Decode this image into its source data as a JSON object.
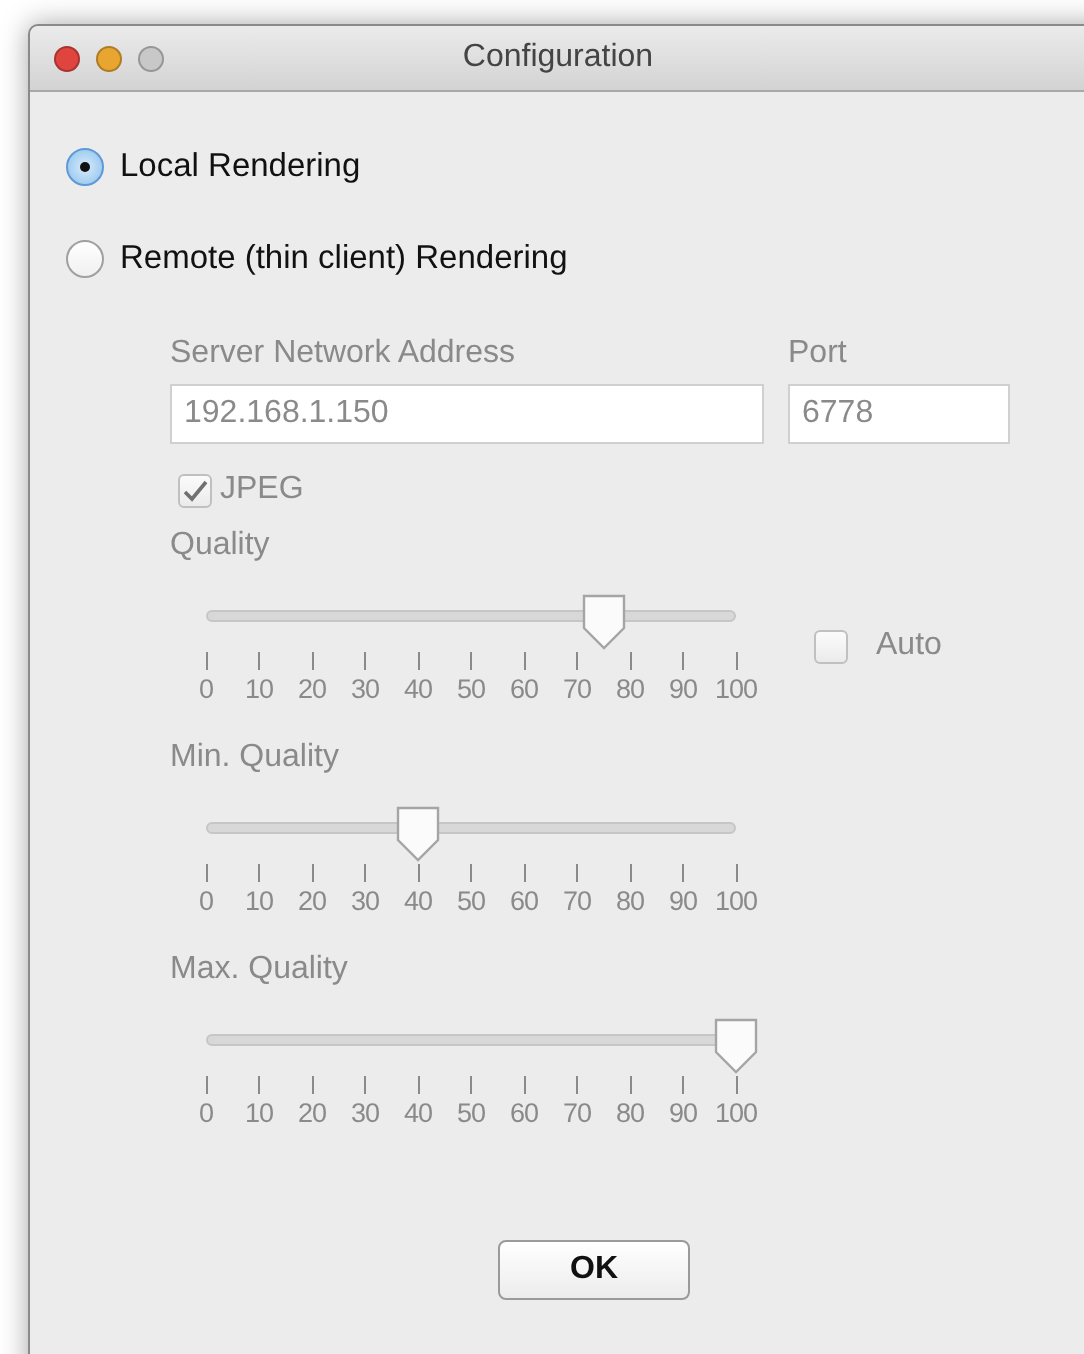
{
  "window": {
    "title": "Configuration"
  },
  "rendering_options": [
    {
      "label": "Local Rendering",
      "selected": true
    },
    {
      "label": "Remote (thin client) Rendering",
      "selected": false
    }
  ],
  "remote_settings": {
    "disabled": true,
    "server_address": {
      "label": "Server Network Address",
      "value": "192.168.1.150"
    },
    "port": {
      "label": "Port",
      "value": "6778"
    },
    "jpeg": {
      "label": "JPEG",
      "checked": true
    },
    "sliders": [
      {
        "label": "Quality",
        "level": 0.75,
        "ticks": [
          "0",
          "10",
          "20",
          "30",
          "40",
          "50",
          "60",
          "70",
          "80",
          "90",
          "100"
        ],
        "auto": {
          "label": "Auto",
          "checked": false
        }
      },
      {
        "label": "Min. Quality",
        "level": 0.4,
        "ticks": [
          "0",
          "10",
          "20",
          "30",
          "40",
          "50",
          "60",
          "70",
          "80",
          "90",
          "100"
        ]
      },
      {
        "label": "Max. Quality",
        "level": 1.0,
        "ticks": [
          "0",
          "10",
          "20",
          "30",
          "40",
          "50",
          "60",
          "70",
          "80",
          "90",
          "100"
        ]
      }
    ]
  },
  "buttons": [
    {
      "label": "OK"
    }
  ]
}
